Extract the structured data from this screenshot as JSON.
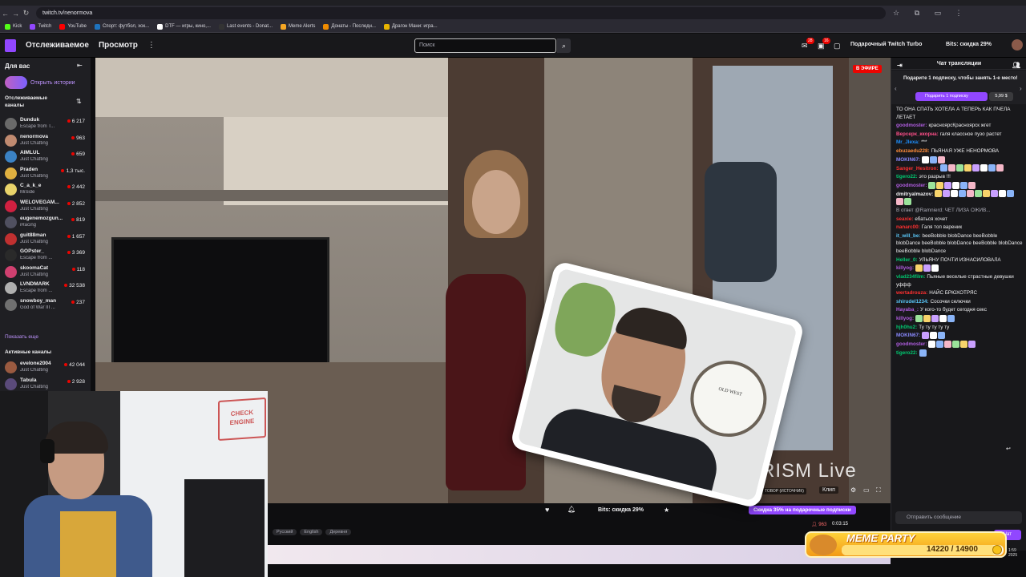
{
  "browser": {
    "url": "twitch.tv/nenormova",
    "bookmarks": [
      {
        "label": "Kick",
        "color": "#53fc18"
      },
      {
        "label": "Twitch",
        "color": "#9147ff"
      },
      {
        "label": "YouTube",
        "color": "#ff0000"
      },
      {
        "label": "Спорт: футбол, хок...",
        "color": "#1e73be"
      },
      {
        "label": "DTF — игры, кино,...",
        "color": "#ffffff"
      },
      {
        "label": "Last events - Donat...",
        "color": "#333333"
      },
      {
        "label": "Meme Alerts",
        "color": "#f5a623"
      },
      {
        "label": "Донаты - Последн...",
        "color": "#f08c00"
      },
      {
        "label": "Драгон Мани: игра...",
        "color": "#e8b400"
      }
    ]
  },
  "topnav": {
    "following": "Отслеживаемое",
    "browse": "Просмотр",
    "search_placeholder": "Поиск",
    "notif_badge_1": "28",
    "notif_badge_2": "16",
    "turbo": "Подарочный Twitch Turbo",
    "bits": "Bits: скидка 29%"
  },
  "sidebar": {
    "header": "Для вас",
    "stories": "Открыть истории",
    "followed_header": "Отслеживаемые каналы",
    "channels": [
      {
        "name": "Dunduk",
        "game": "Escape from T...",
        "viewers": "6 217",
        "color": "#6a6a6a"
      },
      {
        "name": "nenormova",
        "game": "Just Chatting",
        "viewers": "963",
        "color": "#c08a70"
      },
      {
        "name": "AIMLUL",
        "game": "Just Chatting",
        "viewers": "659",
        "color": "#3b82c4"
      },
      {
        "name": "Praden",
        "game": "Just Chatting",
        "viewers": "1,3 тыс.",
        "color": "#e0b040"
      },
      {
        "name": "C_a_k_e",
        "game": "MiSide",
        "viewers": "2 442",
        "color": "#e8d36a"
      },
      {
        "name": "WELOVEGAM...",
        "game": "Just Chatting",
        "viewers": "2 852",
        "color": "#d02040"
      },
      {
        "name": "eugenemozgun...",
        "game": "iRacing",
        "viewers": "819",
        "color": "#505060"
      },
      {
        "name": "guit88man",
        "game": "Just Chatting",
        "viewers": "1 657",
        "color": "#c03030"
      },
      {
        "name": "GOPster_",
        "game": "Escape from ...",
        "viewers": "3 369",
        "color": "#2a2a2a"
      },
      {
        "name": "skoomaCat",
        "game": "Just Chatting",
        "viewers": "118",
        "color": "#d04070"
      },
      {
        "name": "LVNDMARK",
        "game": "Escape from ...",
        "viewers": "32 538",
        "color": "#b0b0b0"
      },
      {
        "name": "snowboy_man",
        "game": "God of War III ...",
        "viewers": "237",
        "color": "#707070"
      }
    ],
    "show_more": "Показать еще",
    "active_header": "Активные каналы",
    "active": [
      {
        "name": "evelone2004",
        "game": "Just Chatting",
        "viewers": "42 044",
        "color": "#9a5a40"
      },
      {
        "name": "Tabula",
        "game": "Just Chatting",
        "viewers": "2 928",
        "color": "#5a4a7a"
      }
    ]
  },
  "video": {
    "live": "В ЭФИРЕ",
    "watermark": "RISM Live",
    "source_badge": "ТОВОР (ИСТОЧНИК)",
    "clip": "Клип",
    "bits_discount": "Bits: скидка 29%",
    "sub_promo": "Скидка 35% на подарочные подписки",
    "viewers": "963",
    "uptime": "0:03:15",
    "tags": [
      "Русский",
      "English",
      "Деревня"
    ],
    "clock_text": "OLD WEST"
  },
  "webcam": {
    "logo_text": "CHECK ENGINE"
  },
  "chat": {
    "title": "Чат трансляции",
    "gift_text": "Подарите 1 подписку, чтобы занять 1-е место!",
    "gift_button": "Подарить 1 подписку",
    "gift_price": "5,99 $",
    "input_placeholder": "Отправить сообщение",
    "send_button": "Чат",
    "messages": [
      {
        "user": "",
        "color": "#efeff1",
        "text": "ТО ОНА СПАТЬ ХОТЕЛА А ТЕПЕРЬ КАК ПЧЕЛА ЛЕТАЕТ"
      },
      {
        "user": "goodmoster:",
        "color": "#b05de0",
        "text": "красноярсКрасноярск жгет"
      },
      {
        "user": "Версерк_ккорна:",
        "color": "#ff4f8a",
        "text": "галя классное пузо растет"
      },
      {
        "user": "Mr_Jlexa:",
        "color": "#1e90ff",
        "text": "***"
      },
      {
        "user": "ebuzaedu228:",
        "color": "#ff8c3a",
        "text": "ПЬЯНАЯ УЖЕ НЕНОРМОВА"
      },
      {
        "user": "MOKIN67:",
        "color": "#8a8aff",
        "text": "",
        "emotes": 3
      },
      {
        "user": "Sanger_Hesitron:",
        "color": "#ff3030",
        "text": "",
        "emotes": 8
      },
      {
        "user": "tigero22:",
        "color": "#00c870",
        "text": "это разрыв !!!"
      },
      {
        "user": "goodmoster:",
        "color": "#b05de0",
        "text": "",
        "emotes": 6
      },
      {
        "user": "dmitryalmazov:",
        "color": "#efeff1",
        "text": "",
        "emotes": 12
      },
      {
        "user": "",
        "color": "#adadb8",
        "text": "В ответ @Ramnierd: ЧЕТ ЛИЗА ОЖИВ..."
      },
      {
        "user": "seaxie:",
        "color": "#ff3030",
        "text": "ебаться хочет"
      },
      {
        "user": "nanarc00:",
        "color": "#ff3030",
        "text": "Галя топ вареник"
      },
      {
        "user": "it_will_be:",
        "color": "#5ac8fa",
        "text": "beeBobble blobDance beeBobble blobDance beeBobble blobDance beeBobble blobDance beeBobble blobDance"
      },
      {
        "user": "Heller_0:",
        "color": "#00c870",
        "text": "УЛЬЯНУ ПОЧТИ ИЗНАСИЛОВАЛА"
      },
      {
        "user": "killyog:",
        "color": "#b05de0",
        "text": "",
        "emotes": 3
      },
      {
        "user": "vlad234film:",
        "color": "#00c870",
        "text": "Пьяные веселые страстные девушки уффф"
      },
      {
        "user": "wertadrouza:",
        "color": "#ff3030",
        "text": "НАЙС БРЮХОТРЯС"
      },
      {
        "user": "shirudel1234:",
        "color": "#5ac8fa",
        "text": "Сосочки селючки"
      },
      {
        "user": "Hayaba_:",
        "color": "#b05de0",
        "text": "У кого-то будет сегодня секс"
      },
      {
        "user": "killyog:",
        "color": "#b05de0",
        "text": "",
        "emotes": 5
      },
      {
        "user": "hjh0hu2:",
        "color": "#00c870",
        "text": "Ту ту ту ту ту"
      },
      {
        "user": "MOKIN67:",
        "color": "#8a8aff",
        "text": "",
        "emotes": 3
      },
      {
        "user": "goodmoster:",
        "color": "#b05de0",
        "text": "",
        "emotes": 6
      },
      {
        "user": "tigero22:",
        "color": "#00c870",
        "text": "",
        "emotes": 1
      }
    ]
  },
  "meme_party": {
    "title": "MEME PARTY",
    "progress": "14220 / 14900",
    "fill_fraction": 0.954
  },
  "clock": {
    "time": "1:59",
    "year": "2025"
  }
}
